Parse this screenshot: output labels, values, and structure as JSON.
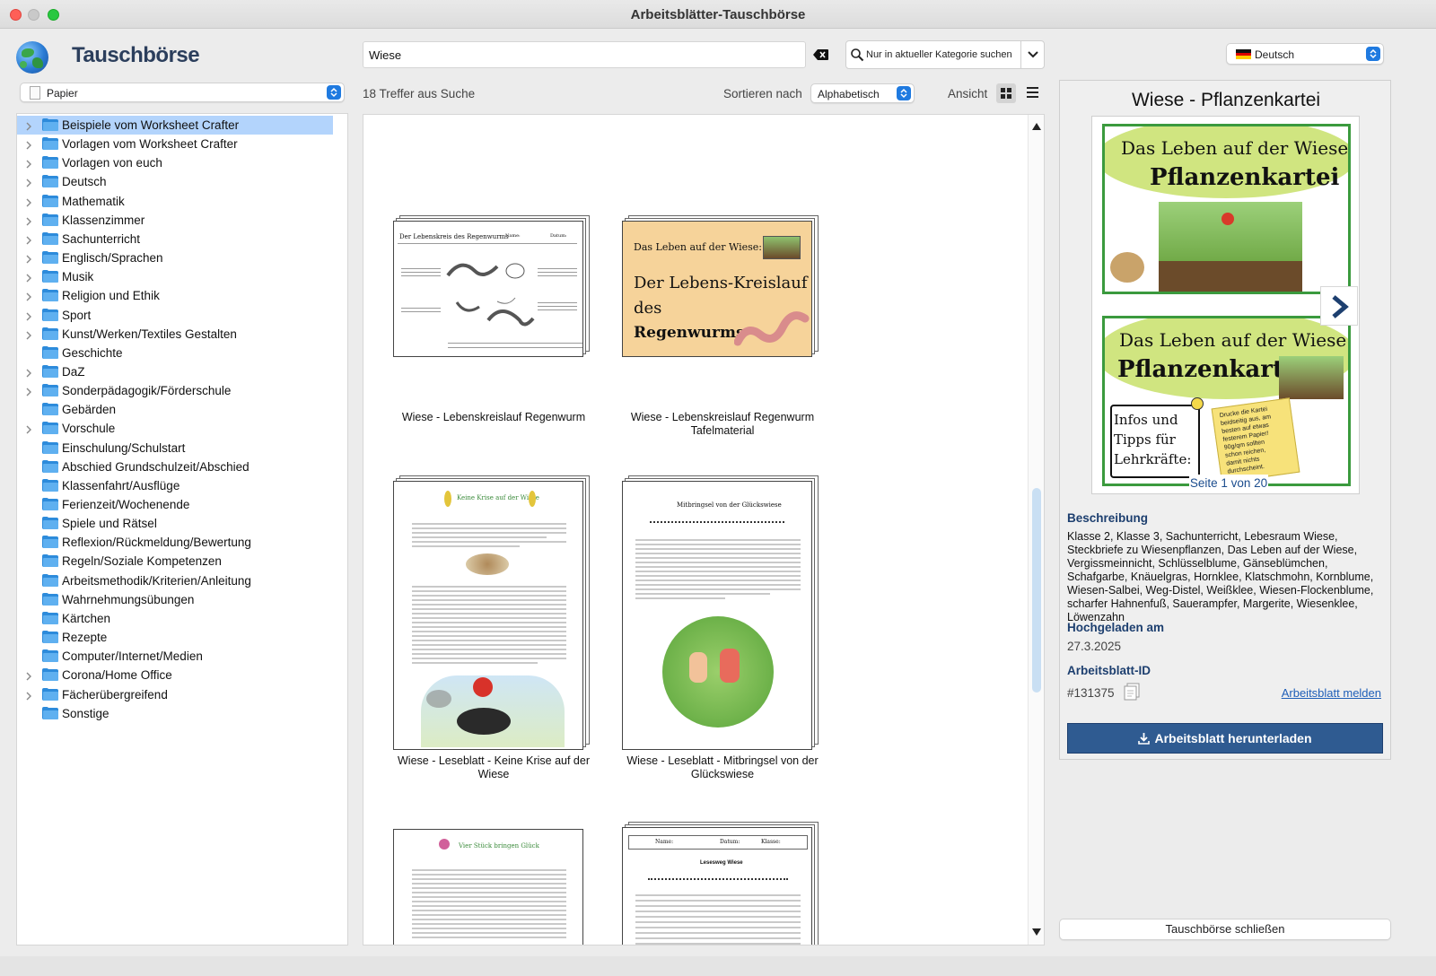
{
  "window": {
    "title": "Arbeitsblätter-Tauschbörse"
  },
  "app": {
    "name": "Tauschbörse"
  },
  "search": {
    "value": "Wiese",
    "scope_label": "Nur in aktueller Kategorie suchen"
  },
  "language": {
    "selected": "Deutsch"
  },
  "category_select": {
    "selected": "Papier"
  },
  "tree": {
    "items": [
      {
        "label": "Beispiele vom Worksheet Crafter",
        "expandable": true,
        "selected": true
      },
      {
        "label": "Vorlagen vom Worksheet Crafter",
        "expandable": true
      },
      {
        "label": "Vorlagen von euch",
        "expandable": true
      },
      {
        "label": "Deutsch",
        "expandable": true
      },
      {
        "label": "Mathematik",
        "expandable": true
      },
      {
        "label": "Klassenzimmer",
        "expandable": true
      },
      {
        "label": "Sachunterricht",
        "expandable": true
      },
      {
        "label": "Englisch/Sprachen",
        "expandable": true
      },
      {
        "label": "Musik",
        "expandable": true
      },
      {
        "label": "Religion und Ethik",
        "expandable": true
      },
      {
        "label": "Sport",
        "expandable": true
      },
      {
        "label": "Kunst/Werken/Textiles Gestalten",
        "expandable": true
      },
      {
        "label": "Geschichte",
        "expandable": false
      },
      {
        "label": "DaZ",
        "expandable": true
      },
      {
        "label": "Sonderpädagogik/Förderschule",
        "expandable": true
      },
      {
        "label": "Gebärden",
        "expandable": false
      },
      {
        "label": "Vorschule",
        "expandable": true
      },
      {
        "label": "Einschulung/Schulstart",
        "expandable": false
      },
      {
        "label": "Abschied Grundschulzeit/Abschied",
        "expandable": false
      },
      {
        "label": "Klassenfahrt/Ausflüge",
        "expandable": false
      },
      {
        "label": "Ferienzeit/Wochenende",
        "expandable": false
      },
      {
        "label": "Spiele und Rätsel",
        "expandable": false
      },
      {
        "label": "Reflexion/Rückmeldung/Bewertung",
        "expandable": false
      },
      {
        "label": "Regeln/Soziale Kompetenzen",
        "expandable": false
      },
      {
        "label": "Arbeitsmethodik/Kriterien/Anleitung",
        "expandable": false
      },
      {
        "label": "Wahrnehmungsübungen",
        "expandable": false
      },
      {
        "label": "Kärtchen",
        "expandable": false
      },
      {
        "label": "Rezepte",
        "expandable": false
      },
      {
        "label": "Computer/Internet/Medien",
        "expandable": false
      },
      {
        "label": "Corona/Home Office",
        "expandable": true
      },
      {
        "label": "Fächerübergreifend",
        "expandable": true
      },
      {
        "label": "Sonstige",
        "expandable": false
      }
    ]
  },
  "toolbar": {
    "results_count": "18 Treffer aus Suche",
    "sort_label": "Sortieren nach",
    "sort_value": "Alphabetisch",
    "view_label": "Ansicht"
  },
  "results": {
    "items": [
      {
        "title": "Wiese - Lebenskreislauf Regenwurm",
        "thumb_text": {
          "heading": "Der Lebenskreis des Regenwurms",
          "name": "Name:",
          "date": "Datum:"
        }
      },
      {
        "title": "Wiese - Lebenskreislauf Regenwurm Tafelmaterial",
        "thumb_text": {
          "top": "Das Leben auf der Wiese:",
          "line1": "Der Lebens-Kreislauf",
          "line2": "des",
          "line3": "Regenwurms"
        }
      },
      {
        "title": "Wiese - Leseblatt - Keine Krise auf der Wiese",
        "thumb_text": {
          "heading": "Keine Krise auf der Wiese"
        }
      },
      {
        "title": "Wiese - Leseblatt - Mitbringsel von der Glückswiese",
        "thumb_text": {
          "heading": "Mitbringsel von der Glückswiese"
        }
      },
      {
        "title": "",
        "thumb_text": {
          "heading": "Vier Stück bringen Glück"
        }
      },
      {
        "title": "",
        "thumb_text": {
          "heading": "Lesesweg Wiese",
          "name": "Name:",
          "date": "Datum:",
          "class": "Klasse:"
        }
      }
    ]
  },
  "detail": {
    "title": "Wiese - Pflanzenkartei",
    "preview": {
      "card1_line1": "Das Leben auf der Wiese",
      "card1_line2": "Pflanzenkartei",
      "card2_line1": "Das Leben auf der Wiese",
      "card2_line2": "Pflanzenkartei",
      "card2_info": [
        "Infos und",
        "Tipps für",
        "Lehrkräfte:"
      ],
      "card2_note": [
        "Drucke die Kartei",
        "beidseitig aus, am",
        "besten auf etwas",
        "festerem Papier!",
        "90g/qm sollten",
        "schon reichen,",
        "damit nichts",
        "durchscheint."
      ],
      "page_indicator": "Seite 1 von 20"
    },
    "description_label": "Beschreibung",
    "description": "Klasse 2, Klasse 3, Sachunterricht, Lebesraum Wiese, Steckbriefe zu Wiesenpflanzen, Das Leben auf der Wiese, Vergissmeinnicht, Schlüsselblume, Gänseblümchen, Schafgarbe, Knäuelgras, Hornklee, Klatschmohn, Kornblume, Wiesen-Salbei, Weg-Distel, Weißklee, Wiesen-Flockenblume, scharfer Hahnenfuß, Sauerampfer, Margerite, Wiesenklee, Löwenzahn",
    "uploaded_label": "Hochgeladen am",
    "uploaded_value": "27.3.2025",
    "id_label": "Arbeitsblatt-ID",
    "id_value": "#131375",
    "report_link": "Arbeitsblatt melden",
    "download_button": "Arbeitsblatt herunterladen"
  },
  "footer": {
    "close_button": "Tauschbörse schließen"
  },
  "colors": {
    "accent": "#1f7ae0",
    "selected_row": "#b3d4fc",
    "download": "#2f5b91",
    "label": "#1d3f6f",
    "card_border": "#3b9a3e"
  }
}
